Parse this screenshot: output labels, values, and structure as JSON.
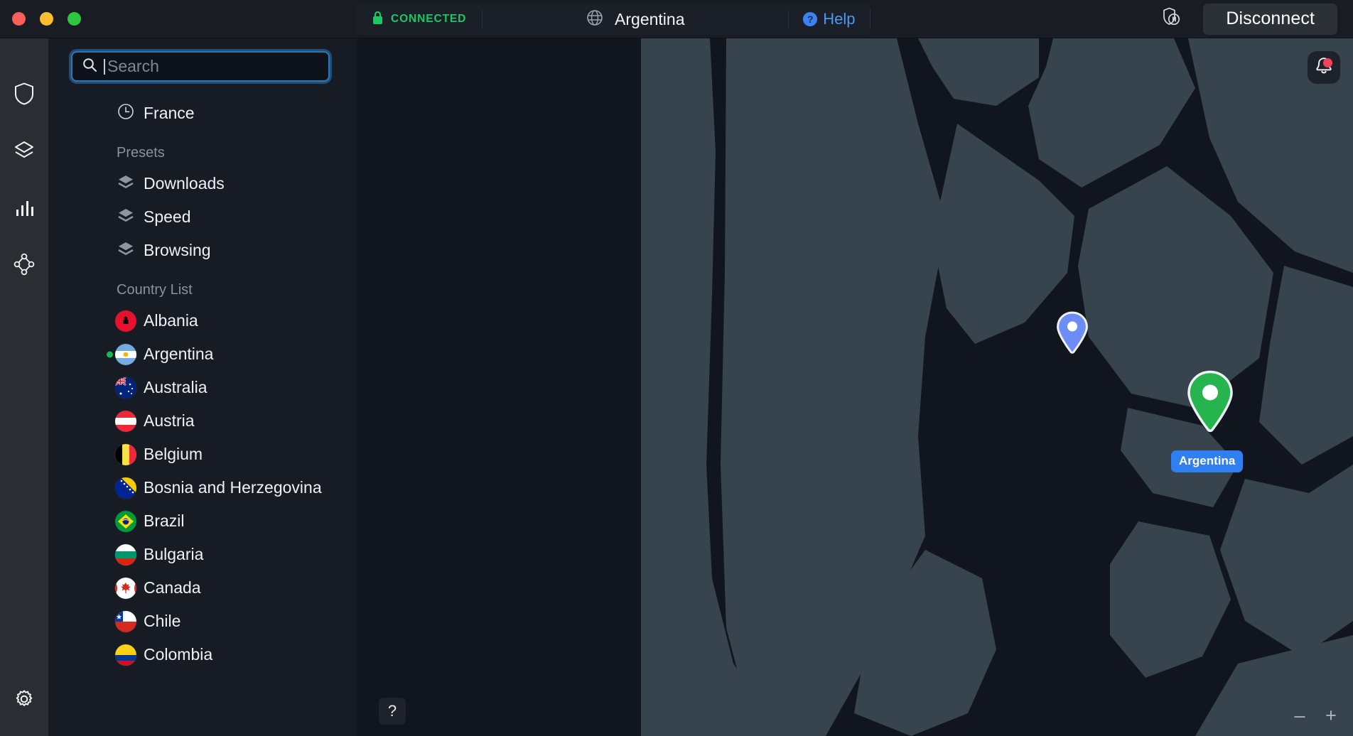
{
  "window": {
    "controls": [
      {
        "name": "close",
        "color": "#fb5f57"
      },
      {
        "name": "minimize",
        "color": "#fcbd2e"
      },
      {
        "name": "zoom",
        "color": "#2bc840"
      }
    ]
  },
  "topbar": {
    "status_label": "CONNECTED",
    "status_color": "#18c964",
    "lock_icon": "lock-closed-icon",
    "globe_icon": "globe-icon",
    "country": "Argentina",
    "help_badge": "?",
    "help_label": "Help",
    "help_color": "#4c97f5",
    "pause_icon": "shield-pause-icon",
    "disconnect_label": "Disconnect"
  },
  "rail": {
    "items": [
      {
        "icon": "shield-icon",
        "name": "sidebar-item-protection"
      },
      {
        "icon": "layers-icon",
        "name": "sidebar-item-presets"
      },
      {
        "icon": "bar-chart-icon",
        "name": "sidebar-item-stats"
      },
      {
        "icon": "network-nodes-icon",
        "name": "sidebar-item-network"
      }
    ],
    "settings_icon": "gear-icon"
  },
  "search": {
    "placeholder": "Search",
    "value": "",
    "icon": "search-icon",
    "focused": true
  },
  "panel": {
    "recent": [
      {
        "label": "France",
        "icon": "clock-icon"
      }
    ],
    "presets_title": "Presets",
    "presets": [
      {
        "label": "Downloads",
        "icon": "layers-icon"
      },
      {
        "label": "Speed",
        "icon": "layers-icon"
      },
      {
        "label": "Browsing",
        "icon": "layers-icon"
      }
    ],
    "country_list_title": "Country List",
    "countries": [
      {
        "label": "Albania",
        "flag": "al",
        "connected": false
      },
      {
        "label": "Argentina",
        "flag": "ar",
        "connected": true
      },
      {
        "label": "Australia",
        "flag": "au",
        "connected": false
      },
      {
        "label": "Austria",
        "flag": "at",
        "connected": false
      },
      {
        "label": "Belgium",
        "flag": "be",
        "connected": false
      },
      {
        "label": "Bosnia and Herzegovina",
        "flag": "ba",
        "connected": false
      },
      {
        "label": "Brazil",
        "flag": "br",
        "connected": false
      },
      {
        "label": "Bulgaria",
        "flag": "bg",
        "connected": false
      },
      {
        "label": "Canada",
        "flag": "ca",
        "connected": false
      },
      {
        "label": "Chile",
        "flag": "cl",
        "connected": false
      },
      {
        "label": "Colombia",
        "flag": "co",
        "connected": false
      }
    ]
  },
  "map": {
    "pins": [
      {
        "name": "secure-core-pin",
        "color": "#6d8cf5",
        "label": null
      },
      {
        "name": "server-pin-argentina",
        "color": "#26b44e",
        "label": "Argentina"
      }
    ],
    "notification_icon": "bell-icon",
    "notification_badge_color": "#f3425f",
    "help_button": "?",
    "zoom_out": "–",
    "zoom_in": "+"
  }
}
